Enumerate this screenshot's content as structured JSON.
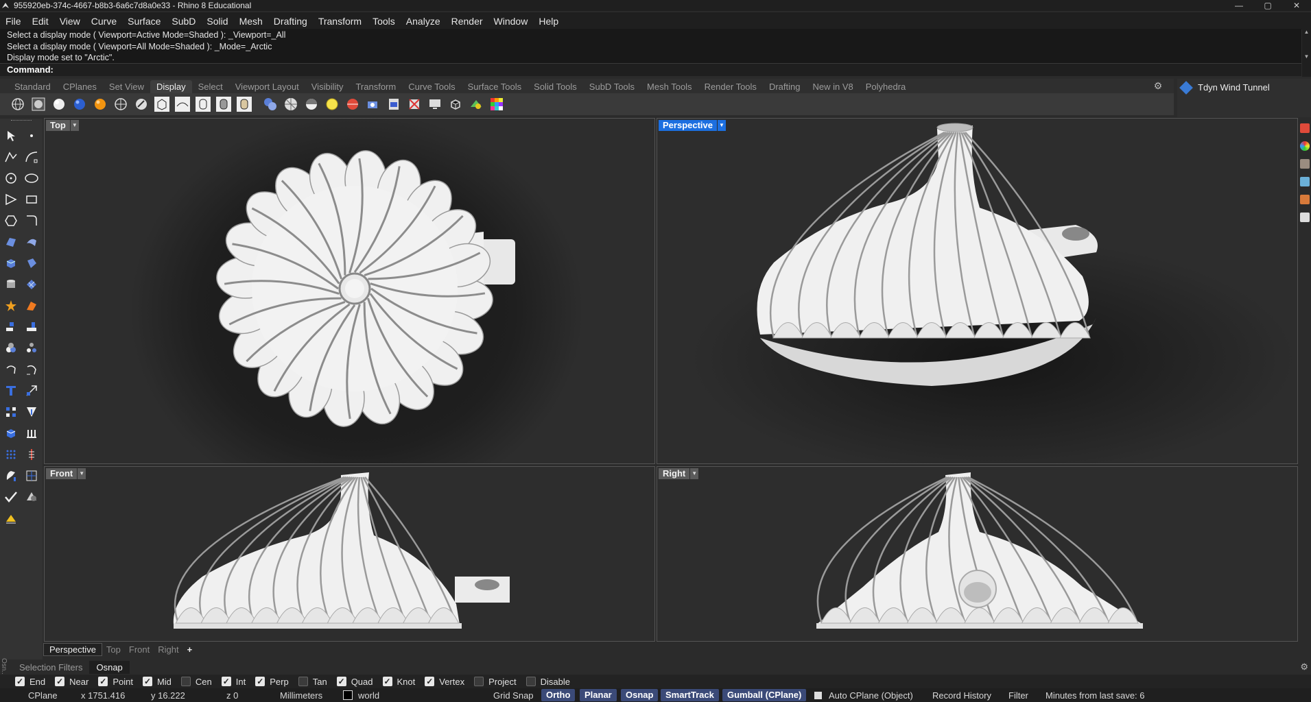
{
  "window": {
    "title": "955920eb-374c-4667-b8b3-6a6c7d8a0e33 - Rhino 8 Educational",
    "controls": [
      "—",
      "▢",
      "✕"
    ]
  },
  "menu": [
    "File",
    "Edit",
    "View",
    "Curve",
    "Surface",
    "SubD",
    "Solid",
    "Mesh",
    "Drafting",
    "Transform",
    "Tools",
    "Analyze",
    "Render",
    "Window",
    "Help"
  ],
  "command_history": [
    "Select a display mode ( Viewport=Active  Mode=Shaded ): _Viewport=_All",
    "Select a display mode ( Viewport=All  Mode=Shaded ): _Mode=_Arctic",
    "Display mode set to \"Arctic\"."
  ],
  "command_prompt": "Command:",
  "toolbar_tabs": [
    "Standard",
    "CPlanes",
    "Set View",
    "Display",
    "Select",
    "Viewport Layout",
    "Visibility",
    "Transform",
    "Curve Tools",
    "Surface Tools",
    "Solid Tools",
    "SubD Tools",
    "Mesh Tools",
    "Render Tools",
    "Drafting",
    "New in V8",
    "Polyhedra"
  ],
  "toolbar_active_tab": "Display",
  "plugin_panel": {
    "label": "Tdyn Wind Tunnel"
  },
  "viewports": {
    "top": "Top",
    "perspective": "Perspective",
    "front": "Front",
    "right": "Right"
  },
  "viewport_tabs": [
    "Perspective",
    "Top",
    "Front",
    "Right",
    "+"
  ],
  "panel_tabs": {
    "side": "Osn...",
    "selection_filters": "Selection Filters",
    "osnap": "Osnap"
  },
  "osnaps": [
    {
      "label": "End",
      "checked": true
    },
    {
      "label": "Near",
      "checked": true
    },
    {
      "label": "Point",
      "checked": true
    },
    {
      "label": "Mid",
      "checked": true
    },
    {
      "label": "Cen",
      "checked": false
    },
    {
      "label": "Int",
      "checked": true
    },
    {
      "label": "Perp",
      "checked": true
    },
    {
      "label": "Tan",
      "checked": false
    },
    {
      "label": "Quad",
      "checked": true
    },
    {
      "label": "Knot",
      "checked": true
    },
    {
      "label": "Vertex",
      "checked": true
    },
    {
      "label": "Project",
      "checked": false
    },
    {
      "label": "Disable",
      "checked": false
    }
  ],
  "status": {
    "cplane": "CPlane",
    "x": "x 1751.416",
    "y": "y 16.222",
    "z": "z 0",
    "units": "Millimeters",
    "layer": "world",
    "grid_snap": "Grid Snap",
    "ortho": "Ortho",
    "planar": "Planar",
    "osnap": "Osnap",
    "smarttrack": "SmartTrack",
    "gumball": "Gumball (CPlane)",
    "auto_cplane": "Auto CPlane (Object)",
    "record_history": "Record History",
    "filter": "Filter",
    "minutes": "Minutes from last save: 6"
  },
  "colors": {
    "accent": "#1c6fe0",
    "status_button": "#3b4a78",
    "model": "#f2f2f2",
    "background": "#2d2d2d"
  }
}
